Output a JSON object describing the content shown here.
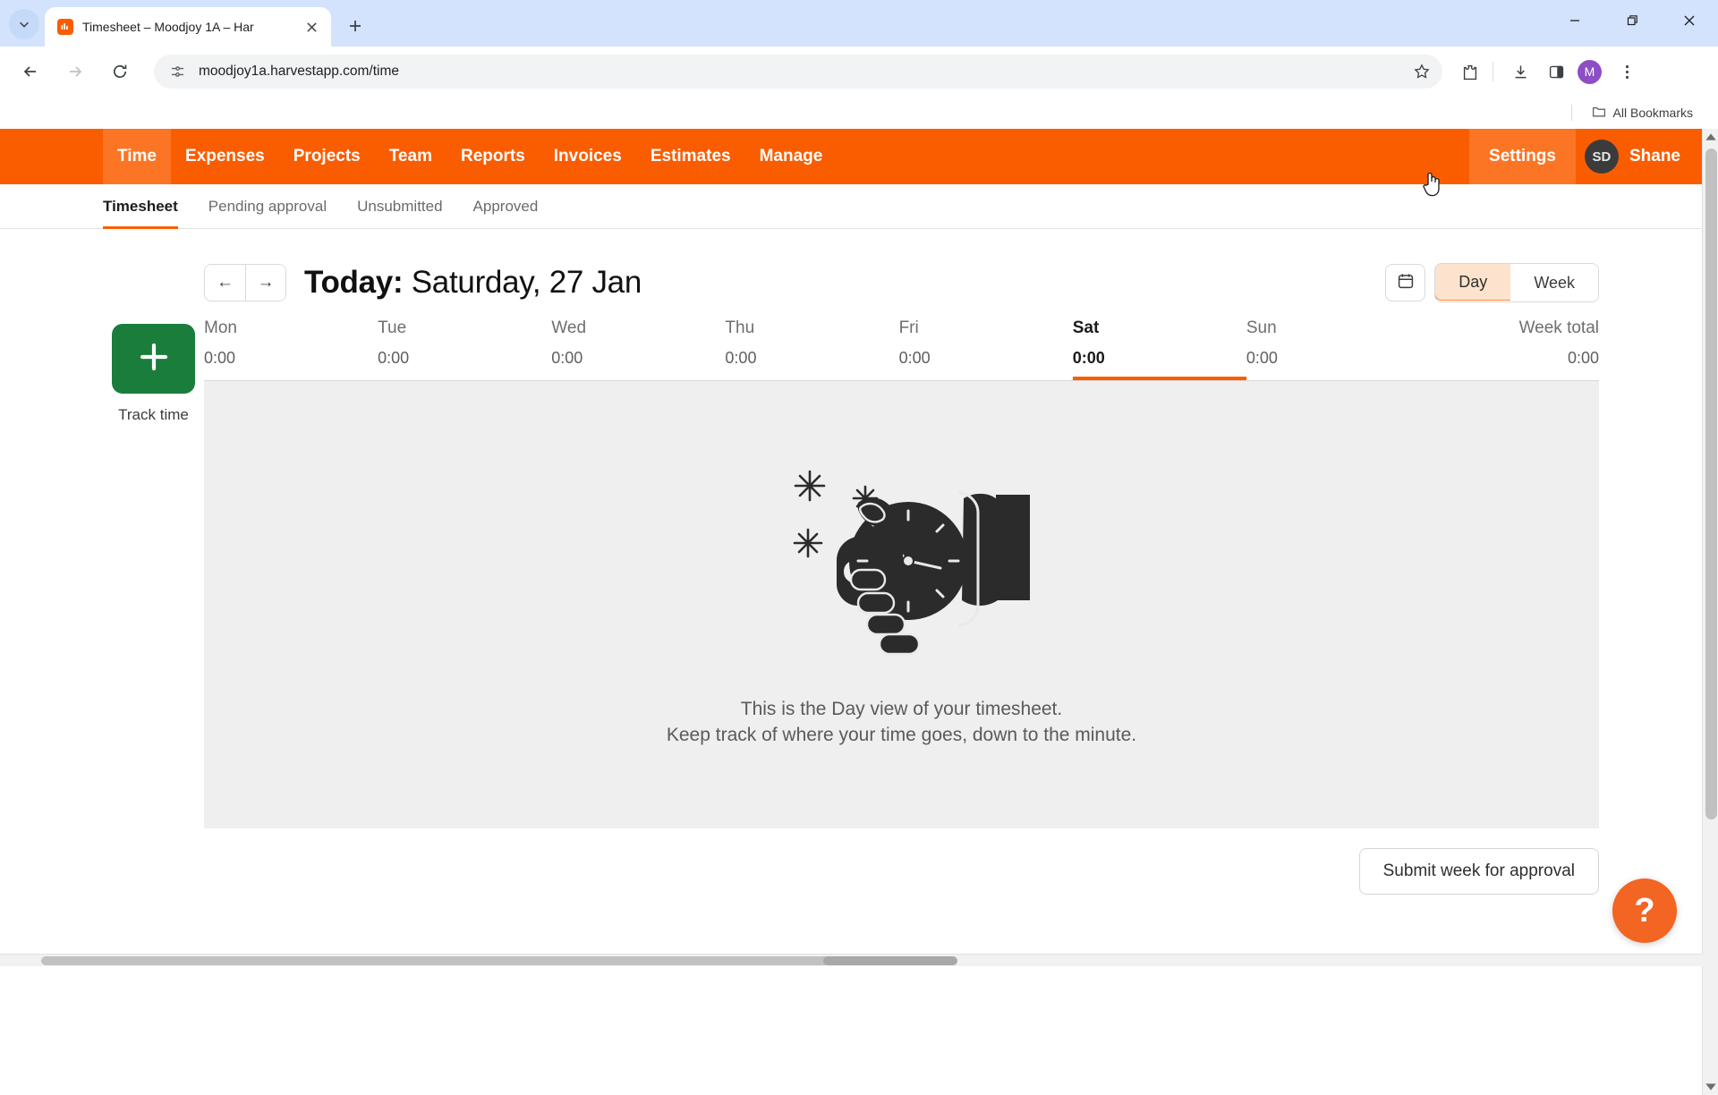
{
  "browser": {
    "tab": {
      "title": "Timesheet – Moodjoy 1A – Har",
      "favicon": "harvest-bar-chart-icon",
      "close_icon": "close-icon"
    },
    "tab_list_icon": "chevron-down-icon",
    "new_tab_icon": "plus-icon",
    "window_controls": {
      "minimize": "minimize-icon",
      "maximize": "restore-icon",
      "close": "close-icon"
    },
    "toolbar": {
      "back_icon": "arrow-left-icon",
      "forward_icon": "arrow-right-icon",
      "reload_icon": "reload-icon",
      "site_info_icon": "page-settings-icon",
      "url": "moodjoy1a.harvestapp.com/time",
      "bookmark_icon": "star-icon",
      "extensions_icon": "puzzle-piece-icon",
      "download_icon": "download-icon",
      "side_panel_icon": "side-panel-icon",
      "profile_initial": "M",
      "menu_icon": "three-dot-menu-icon"
    },
    "bookmarks": {
      "all_bookmarks_label": "All Bookmarks",
      "folder_icon": "folder-icon"
    }
  },
  "app": {
    "nav": {
      "items": [
        {
          "label": "Time",
          "active": true
        },
        {
          "label": "Expenses",
          "active": false
        },
        {
          "label": "Projects",
          "active": false
        },
        {
          "label": "Team",
          "active": false
        },
        {
          "label": "Reports",
          "active": false
        },
        {
          "label": "Invoices",
          "active": false
        },
        {
          "label": "Estimates",
          "active": false
        },
        {
          "label": "Manage",
          "active": false
        }
      ],
      "settings_label": "Settings",
      "user_initials": "SD",
      "user_name": "Shane",
      "accent_color": "#fa5d00",
      "accent_hover_color": "#fb7524"
    },
    "subtabs": [
      {
        "label": "Timesheet",
        "active": true
      },
      {
        "label": "Pending approval",
        "active": false
      },
      {
        "label": "Unsubmitted",
        "active": false
      },
      {
        "label": "Approved",
        "active": false
      }
    ],
    "header": {
      "prev_arrow": "←",
      "next_arrow": "→",
      "today_prefix": "Today:",
      "date": "Saturday, 27 Jan",
      "calendar_icon": "calendar-icon",
      "view_options": [
        {
          "label": "Day",
          "selected": true
        },
        {
          "label": "Week",
          "selected": false
        }
      ]
    },
    "track": {
      "icon": "plus-icon",
      "label": "Track time"
    },
    "week": {
      "days": [
        {
          "name": "Mon",
          "hours": "0:00",
          "active": false
        },
        {
          "name": "Tue",
          "hours": "0:00",
          "active": false
        },
        {
          "name": "Wed",
          "hours": "0:00",
          "active": false
        },
        {
          "name": "Thu",
          "hours": "0:00",
          "active": false
        },
        {
          "name": "Fri",
          "hours": "0:00",
          "active": false
        },
        {
          "name": "Sat",
          "hours": "0:00",
          "active": true
        },
        {
          "name": "Sun",
          "hours": "0:00",
          "active": false
        }
      ],
      "total_label": "Week total",
      "total_hours": "0:00"
    },
    "empty_state": {
      "illustration": "hand-holding-clock-illustration",
      "line1": "This is the Day view of your timesheet.",
      "line2": "Keep track of where your time goes, down to the minute."
    },
    "submit_label": "Submit week for approval",
    "help_label": "?"
  }
}
